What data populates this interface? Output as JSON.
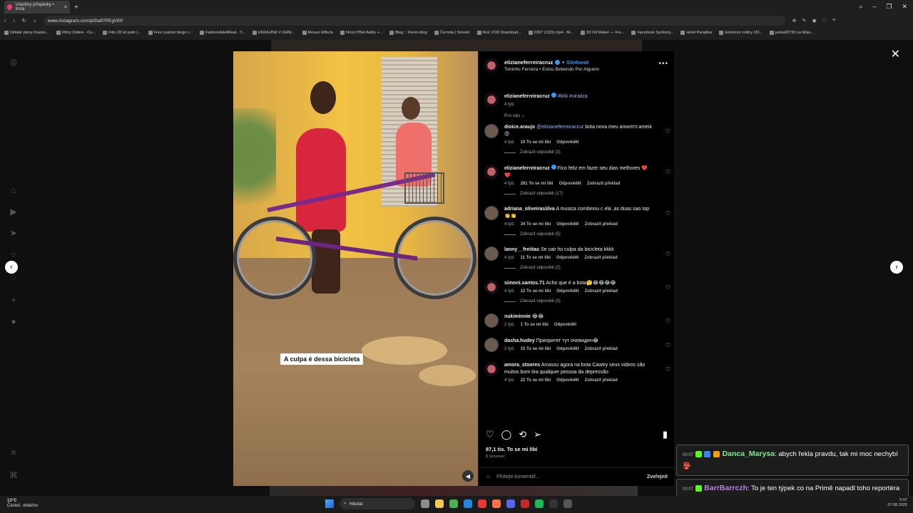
{
  "browser": {
    "tab_title": "Všechny příspěvky • Insta",
    "url": "www.instagram.com/p/DaIf7PEgVEf/",
    "bookmarks": [
      "Dětské pleny hrazen...",
      "Filmy Online - Ou...",
      "Film 28 let poté (...",
      "Free custom bingo c...",
      "FashionAdellReal - Y...",
      "UKRAJINA V OHNI...",
      "Movavi Effects",
      "Nový Přítel Adély +...",
      "Blog :: Fionin-blog",
      "Černota | Stream",
      "Kick VOD Download...",
      "0307 (13)5).mp4 - M...",
      "3D Gif Maker — Fre...",
      "Facebook Symboly...",
      "Hotel Paradise",
      "Extrémní rodiny (20...",
      "janka00733 na Moje..."
    ]
  },
  "video": {
    "caption": "A culpa é dessa bicicleta"
  },
  "post": {
    "author": "elizianeferreiracruz",
    "follow_label": "Sledovat",
    "bullet": "•",
    "audio": "Toninho Ferreira • Estou Bebendo Por Alguém",
    "caption_user": "elizianeferreiracruz",
    "caption_text": "#kkk #viraliza",
    "caption_time": "4 týd.",
    "sort_label": "Pro vás",
    "comments": [
      {
        "user": "dioice.araujo",
        "mention": "@elizianeferreiracruz",
        "text": " bota nova meu amorrrrr.ameiii😍",
        "time": "4 týd.",
        "likes": "10 To se mi líbí",
        "reply": "Odpovědět",
        "translate": "",
        "replies": "Zobrazit odpovědi (3)"
      },
      {
        "user": "elizianeferreiracruz",
        "mention": "",
        "text": " Fico feliz em fazer seu dias melhores ❤️ ❤️",
        "time": "4 týd.",
        "likes": "281 To se mi líbí",
        "reply": "Odpovědět",
        "translate": "Zobrazit překlad",
        "replies": "Zobrazit odpovědi (17)"
      },
      {
        "user": "adriana_oliveirasiilva",
        "mention": "",
        "text": " A musica combinou c ela ,as duas sao top 👏👏",
        "time": "4 týd.",
        "likes": "34 To se mi líbí",
        "reply": "Odpovědět",
        "translate": "Zobrazit překlad",
        "replies": "Zobrazit odpovědi (5)"
      },
      {
        "user": "lanny__freiitas",
        "mention": "",
        "text": " Se cair foi culpa da bicicleta kkkk",
        "time": "4 týd.",
        "likes": "11 To se mi líbí",
        "reply": "Odpovědět",
        "translate": "Zobrazit překlad",
        "replies": "Zobrazit odpovědi (2)"
      },
      {
        "user": "simoni.santos.71",
        "mention": "",
        "text": " Acho que é a bota🤔😂😂😂😂",
        "time": "4 týd.",
        "likes": "12 To se mi líbí",
        "reply": "Odpovědět",
        "translate": "Zobrazit překlad",
        "replies": "Zobrazit odpovědi (3)"
      },
      {
        "user": "nukiminnie",
        "mention": "",
        "text": " 😂😂",
        "time": "2 týd.",
        "likes": "1 To se mi líbí",
        "reply": "Odpovědět",
        "translate": "",
        "replies": ""
      },
      {
        "user": "dasha.hudey",
        "mention": "",
        "text": " Приоритет тут очевиден😂",
        "time": "2 týd.",
        "likes": "15 To se mi líbí",
        "reply": "Odpovědět",
        "translate": "Zobrazit překlad",
        "replies": ""
      },
      {
        "user": "amora_stoores",
        "mention": "",
        "text": " Arrasou agora na bota Cawtry seus videos são muitos bom tira qualquer pessoa da depressão",
        "time": "4 týd.",
        "likes": "22 To se mi líbí",
        "reply": "Odpovědět",
        "translate": "Zobrazit překlad",
        "replies": ""
      }
    ],
    "likes_total": "87,1 tis. To se mi líbí",
    "date": "8 červenec",
    "comment_placeholder": "Přidejte komentář...",
    "publish_label": "Zveřejnit"
  },
  "chat": [
    {
      "time": "00:07",
      "user": "Danca_Marysa",
      "text": ": abych řekla pravdu, tak mi moc nechybí 👺"
    },
    {
      "time": "00:07",
      "user": "BarrBarrczh",
      "text": ": To je ten týpek co na Primě napadl toho reportéra"
    }
  ],
  "taskbar": {
    "temperature": "13°C",
    "weather": "Částeč. oblačno",
    "search_label": "Hledat",
    "time": "0:07",
    "date": "07.08.2025"
  }
}
